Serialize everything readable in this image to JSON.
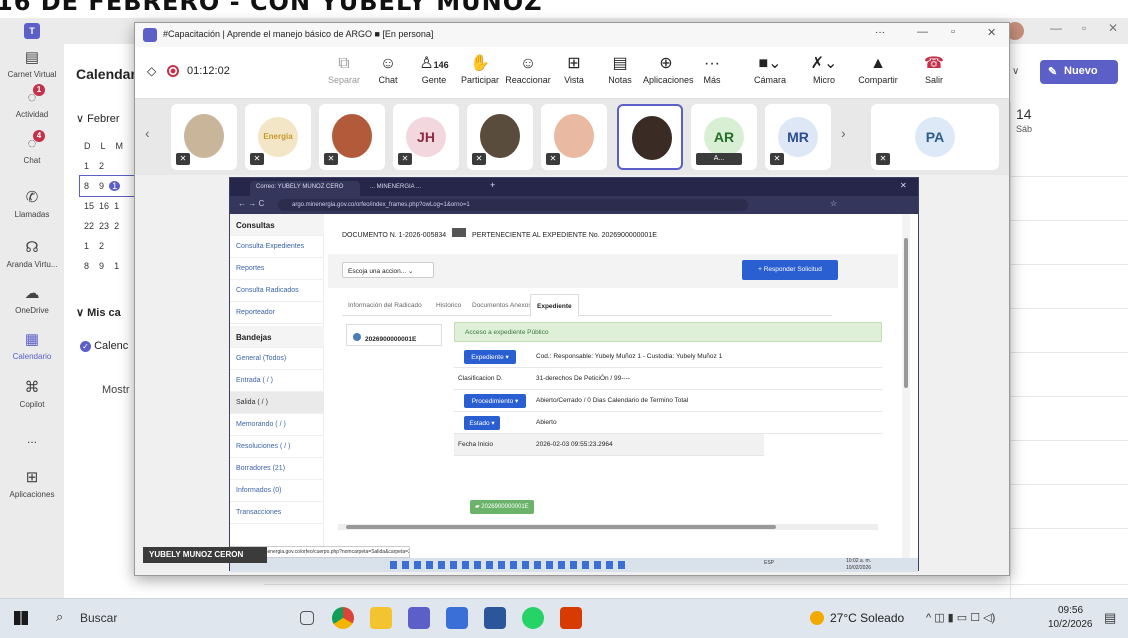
{
  "banner_text": "16 DE FEBRERO - CON YUBELY MUÑOZ",
  "teams": {
    "rail": [
      {
        "label": "Carnet Virtual",
        "icon": "id-card-icon"
      },
      {
        "label": "Actividad",
        "icon": "bell-icon",
        "badge": "1"
      },
      {
        "label": "Chat",
        "icon": "chat-icon",
        "badge": "4"
      },
      {
        "label": "Llamadas",
        "icon": "phone-icon"
      },
      {
        "label": "Aranda Virtu...",
        "icon": "headset-icon"
      },
      {
        "label": "OneDrive",
        "icon": "cloud-icon"
      },
      {
        "label": "Calendario",
        "icon": "calendar-icon"
      },
      {
        "label": "Copilot",
        "icon": "copilot-icon"
      },
      {
        "label": "...",
        "icon": "more-icon"
      },
      {
        "label": "Aplicaciones",
        "icon": "plus-icon"
      }
    ],
    "calendar_title": "Calendar",
    "month_label": "Febrer",
    "mini_header": [
      "D",
      "L",
      "M"
    ],
    "mini_rows": [
      [
        "1",
        "2"
      ],
      [
        "8",
        "9",
        "1"
      ],
      [
        "15",
        "16",
        "1"
      ],
      [
        "22",
        "23",
        "2"
      ],
      [
        "1",
        "2"
      ],
      [
        "8",
        "9",
        "1"
      ]
    ],
    "my_calendars": "Mis ca",
    "calendar_item": "Calenc",
    "show_more": "Mostr",
    "new_button": "Nuevo",
    "day_number": "14",
    "day_name": "Sáb"
  },
  "meeting": {
    "title": "#Capacitación | Aprende el manejo básico de ARGO ■ [En persona]",
    "timer": "01:12:02",
    "tools": [
      {
        "label": "Separar",
        "icon": "pop-out-icon"
      },
      {
        "label": "Chat",
        "icon": "chat-icon"
      },
      {
        "label": "Gente",
        "icon": "people-icon",
        "count": "146"
      },
      {
        "label": "Participar",
        "icon": "raise-hand-icon"
      },
      {
        "label": "Reaccionar",
        "icon": "emoji-icon"
      },
      {
        "label": "Vista",
        "icon": "grid-icon"
      },
      {
        "label": "Notas",
        "icon": "notes-icon"
      },
      {
        "label": "Aplicaciones",
        "icon": "apps-icon"
      },
      {
        "label": "Más",
        "icon": "more-icon"
      },
      {
        "label": "Cámara",
        "icon": "camera-off-icon"
      },
      {
        "label": "Micro",
        "icon": "mic-off-icon"
      },
      {
        "label": "Compartir",
        "icon": "share-icon"
      },
      {
        "label": "Salir",
        "icon": "hangup-icon"
      }
    ],
    "participants": [
      {
        "initials": "",
        "color": "#c9b59a"
      },
      {
        "initials": "",
        "color": "#e3c25a",
        "text": "Energia"
      },
      {
        "initials": "",
        "color": "#b25a3a"
      },
      {
        "initials": "JH",
        "color": "#f3d7de",
        "fg": "#8d2b45"
      },
      {
        "initials": "",
        "color": "#5a4c3c"
      },
      {
        "initials": "",
        "color": "#e9b9a2"
      },
      {
        "initials": "",
        "color": "#3a2b24"
      },
      {
        "initials": "AR",
        "color": "#d9efd3",
        "fg": "#236e29",
        "label": "A..."
      },
      {
        "initials": "MR",
        "color": "#dde7f6",
        "fg": "#2b4d8d"
      },
      {
        "initials": "PA",
        "color": "#dde9f6",
        "fg": "#2b5d8d"
      }
    ],
    "presenter": "YUBELY MUNOZ CERON"
  },
  "browser": {
    "tabs": [
      "Correo: YUBELY MUNOZ CERO",
      "... MINENERGIA ..."
    ],
    "url": "argo.minenergia.gov.co/orfeo/index_frames.php?owLog=1&orno=1",
    "status_url": "https://argo.minenergia.gov.co/orfeo/cuerpo.php?nomcarpeta=Salida&carpeta=2...",
    "sidebar": {
      "consultas": "Consultas",
      "items1": [
        "Consulta Expedientes",
        "Reportes",
        "Consulta Radicados",
        "Reporteador"
      ],
      "bandejas": "Bandejas",
      "items2": [
        "General (Todos)",
        "Entrada ( / )",
        "Salida ( / )",
        "Memorando ( / )",
        "Resoluciones ( / )",
        "Borradores (21)",
        "Informados (0)",
        "Transacciones"
      ]
    },
    "doc_header": "DOCUMENTO N. 1-2026-005834",
    "doc_expediente": "PERTENECIENTE AL EXPEDIENTE No. 2026900000001E",
    "action_select": "Escoja una accion...",
    "respond_button": "+ Responder Solicitud",
    "tabs_inner": [
      "Información del Radicado",
      "Historico",
      "Documentos Anexos",
      "Expediente"
    ],
    "exp_number": "2026900000001E",
    "access": "Acceso a expediente Público",
    "rows": [
      {
        "label": "Expediente ▾",
        "value": "Cod.: Responsable: Yubely Muñoz 1 - Custodia: Yubely Muñoz 1",
        "button": true
      },
      {
        "label": "Clasificacion D.",
        "value": "31-derechos De PeticiÓn / 99----",
        "button": false
      },
      {
        "label": "Procedimiento ▾",
        "value": "Abierto/Cerrado / 0 Dias Calendario de Termino Total",
        "button": true
      },
      {
        "label": "Estado ▾",
        "value": "Abierto",
        "button": true
      },
      {
        "label": "Fecha Inicio",
        "value": "2026-02-03 09:55:23.2964",
        "button": false
      }
    ],
    "folder": "2026900000001E",
    "tray": {
      "lang": "ESP",
      "time": "10:02 a. m.",
      "date": "10/02/2026"
    }
  },
  "taskbar": {
    "search": "Buscar",
    "weather": "27°C Soleado",
    "time": "09:56",
    "date": "10/2/2026"
  }
}
